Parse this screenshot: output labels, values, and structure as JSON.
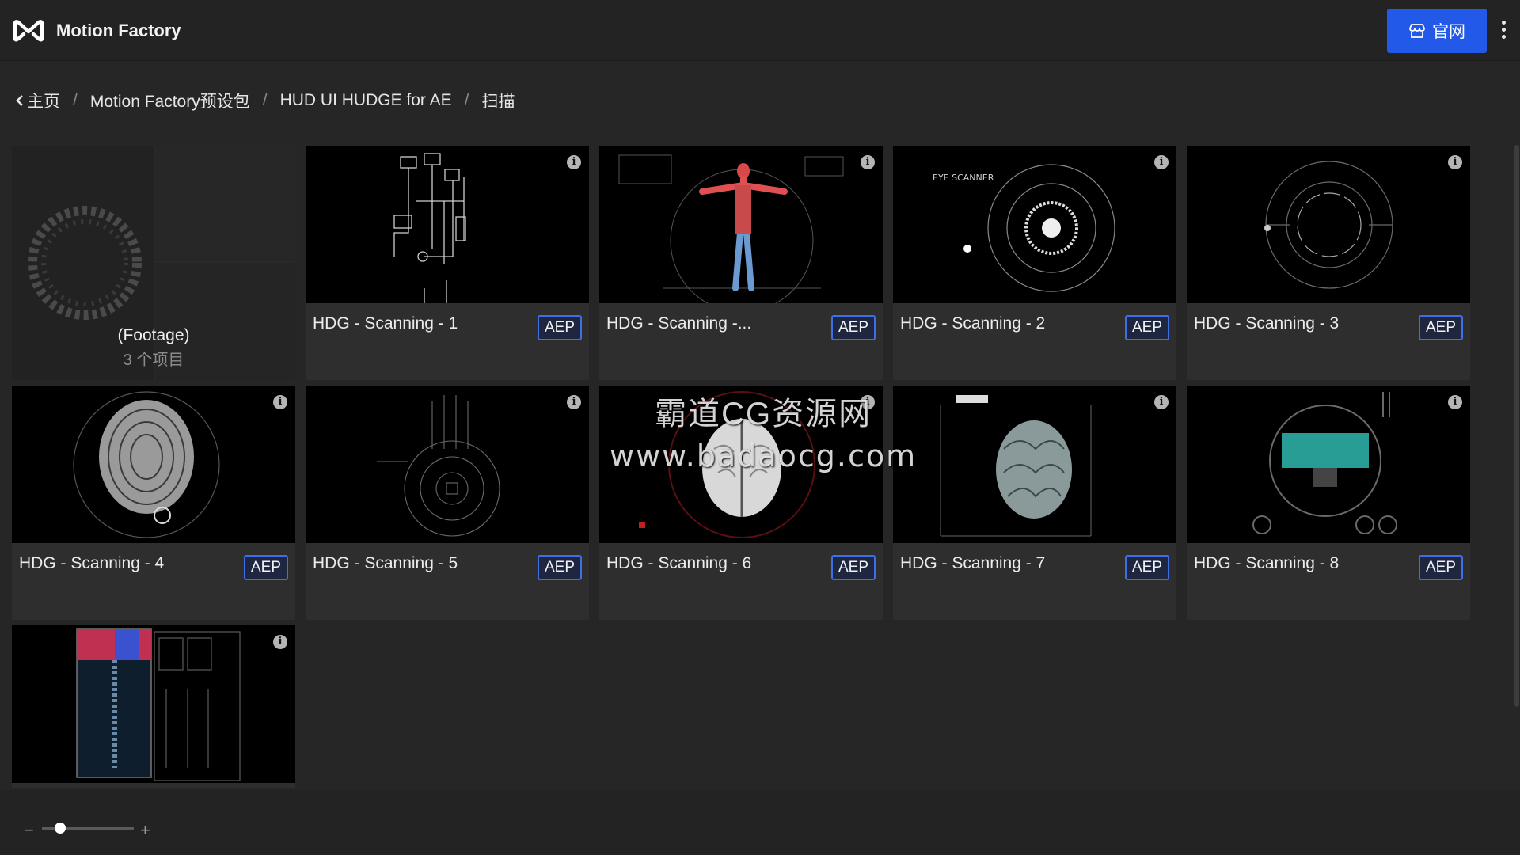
{
  "header": {
    "title": "Motion Factory",
    "site_button_label": "官网",
    "more_icon": "more-vertical-icon"
  },
  "breadcrumb": [
    {
      "label": "主页"
    },
    {
      "label": "Motion Factory预设包"
    },
    {
      "label": "HUD UI HUDGE for AE"
    },
    {
      "label": "扫描"
    }
  ],
  "folder": {
    "name": "(Footage)",
    "count": "3 个项目"
  },
  "cards": [
    {
      "name": "HDG - Scanning - 1",
      "badge": "AEP"
    },
    {
      "name": "HDG - Scanning -...",
      "badge": "AEP"
    },
    {
      "name": "HDG - Scanning - 2",
      "badge": "AEP"
    },
    {
      "name": "HDG - Scanning - 3",
      "badge": "AEP"
    },
    {
      "name": "HDG - Scanning - 4",
      "badge": "AEP"
    },
    {
      "name": "HDG - Scanning - 5",
      "badge": "AEP"
    },
    {
      "name": "HDG - Scanning - 6",
      "badge": "AEP"
    },
    {
      "name": "HDG - Scanning - 7",
      "badge": "AEP"
    },
    {
      "name": "HDG - Scanning - 8",
      "badge": "AEP"
    }
  ],
  "watermark": {
    "line1": "霸道CG资源网",
    "line2": "www.badaocg.com"
  },
  "footer": {
    "zoom_minus": "−",
    "zoom_plus": "+",
    "zoom_level": 0.2
  },
  "colors": {
    "accent": "#2259e8",
    "badge_border": "#3f6fe6",
    "background": "#262626"
  }
}
